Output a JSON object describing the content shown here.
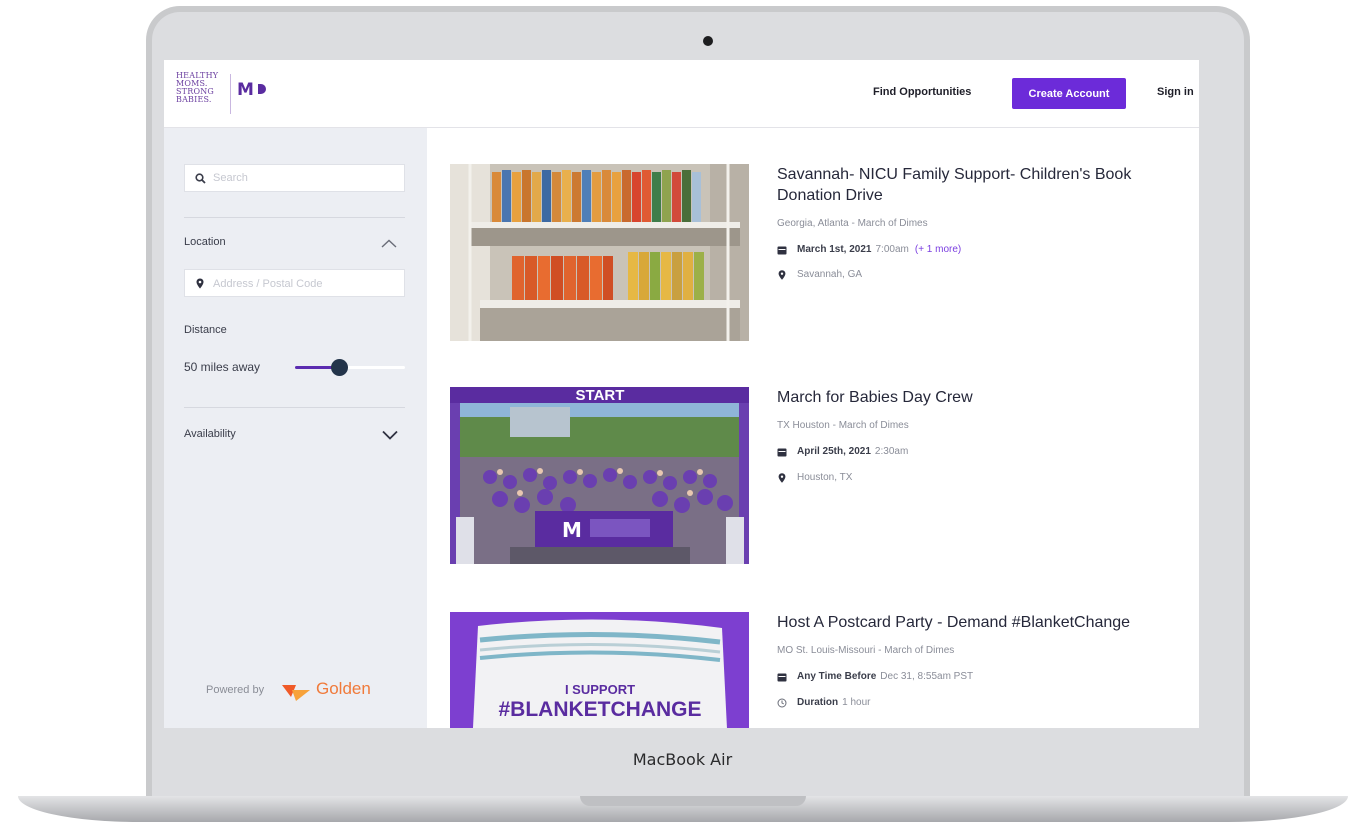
{
  "device_label": "MacBook Air",
  "header": {
    "logo_text": [
      "HEALTHY",
      "MOMS.",
      "STRONG",
      "BABIES."
    ],
    "logo_mark": "M",
    "nav_find": "Find Opportunities",
    "nav_create": "Create Account",
    "nav_signin": "Sign in"
  },
  "sidebar": {
    "search_placeholder": "Search",
    "location_label": "Location",
    "address_placeholder": "Address / Postal Code",
    "distance_label": "Distance",
    "distance_value": "50 miles away",
    "distance_fraction": 0.4,
    "availability_label": "Availability",
    "powered_by": "Powered by",
    "powered_brand": "Golden"
  },
  "opportunities": [
    {
      "title": "Savannah- NICU Family Support- Children's Book Donation Drive",
      "org": "Georgia, Atlanta - March of Dimes",
      "date_bold": "March 1st, 2021",
      "date_rest": "7:00am",
      "date_more": "(+ 1 more)",
      "location": "Savannah, GA",
      "image": "bookshelf-photo"
    },
    {
      "title": "March for Babies Day Crew",
      "org": "TX Houston - March of Dimes",
      "date_bold": "April 25th, 2021",
      "date_rest": "2:30am",
      "location": "Houston, TX",
      "image": "crowd-start-photo",
      "banner_text": "START",
      "banner_logo": "M"
    },
    {
      "title": "Host A Postcard Party - Demand #BlanketChange",
      "org": "MO St. Louis-Missouri - March of Dimes",
      "date_bold": "Any Time Before",
      "date_rest": "Dec 31, 8:55am PST",
      "duration_bold": "Duration",
      "duration_rest": "1 hour",
      "image": "blanket-photo",
      "banner_line1": "I SUPPORT",
      "banner_line2": "#BLANKETCHANGE"
    }
  ],
  "colors": {
    "accent": "#6c2bd9",
    "sidebar_bg": "#eceef3",
    "slider_fill": "#5b2cb0",
    "golden_orange": "#f07a3a"
  }
}
